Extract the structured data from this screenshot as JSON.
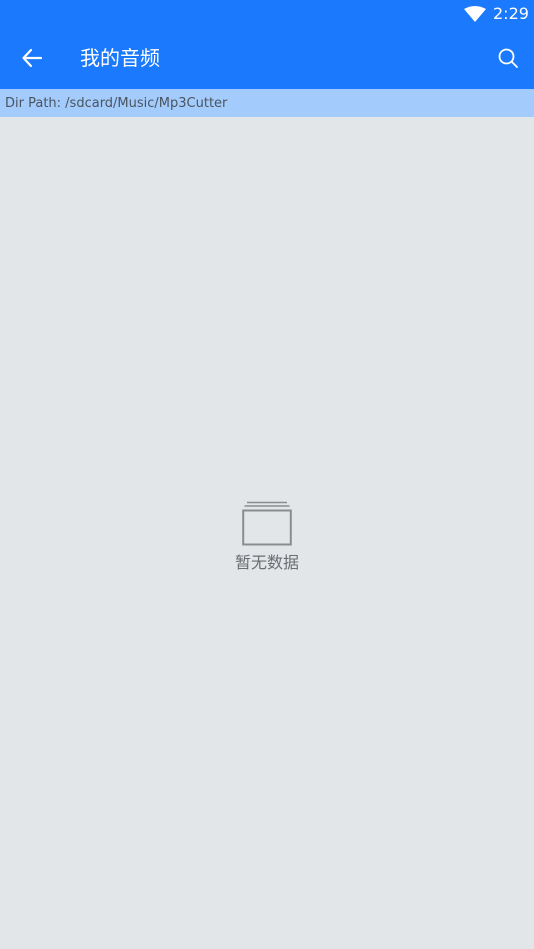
{
  "status_bar": {
    "time": "2:29",
    "icons": [
      "wifi-icon"
    ]
  },
  "app_bar": {
    "title": "我的音频",
    "back_icon": "arrow-left-icon",
    "search_icon": "search-icon"
  },
  "path_bar": {
    "text": "Dir Path: /sdcard/Music/Mp3Cutter"
  },
  "empty_state": {
    "icon": "empty-folder-icon",
    "text": "暂无数据"
  },
  "colors": {
    "primary": "#1a79fd",
    "path_bar": "#a3cbfb",
    "background": "#e2e6e8"
  }
}
